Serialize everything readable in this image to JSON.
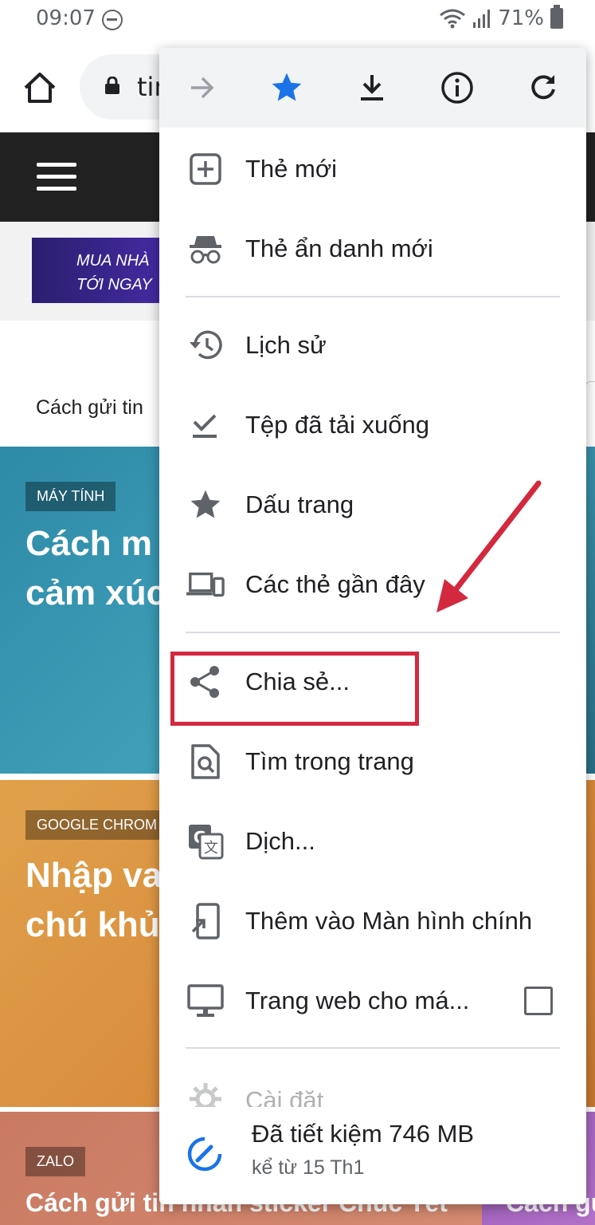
{
  "status_bar": {
    "time": "09:07",
    "battery": "71%"
  },
  "toolbar": {
    "url_fragment": "tin"
  },
  "ad": {
    "line1": "MUA NHÀ",
    "line2": "TỚI NGAY"
  },
  "page": {
    "caption": "Cách gửi tin"
  },
  "cards": [
    {
      "tag": "MÁY TÍNH",
      "title_line1": "Cách m",
      "title_line2": "cảm xúc"
    },
    {
      "tag": "GOOGLE CHROM",
      "title_line1": "Nhập va",
      "title_line2": "chú khủ"
    },
    {
      "tag": "ZALO",
      "title": "Cách gửi tin nhắn sticker Chúc Tết"
    },
    {
      "title": "Cách gử"
    }
  ],
  "menu": {
    "top_icons": [
      "forward-icon",
      "bookmark-star-icon",
      "download-icon",
      "info-icon",
      "reload-icon"
    ],
    "items": [
      {
        "label": "Thẻ mới",
        "icon": "new-tab-icon"
      },
      {
        "label": "Thẻ ẩn danh mới",
        "icon": "incognito-icon"
      },
      {
        "label": "Lịch sử",
        "icon": "history-icon"
      },
      {
        "label": "Tệp đã tải xuống",
        "icon": "downloads-icon"
      },
      {
        "label": "Dấu trang",
        "icon": "bookmarks-icon"
      },
      {
        "label": "Các thẻ gần đây",
        "icon": "recent-tabs-icon"
      },
      {
        "label": "Chia sẻ...",
        "icon": "share-icon"
      },
      {
        "label": "Tìm trong trang",
        "icon": "find-in-page-icon"
      },
      {
        "label": "Dịch...",
        "icon": "translate-icon"
      },
      {
        "label": "Thêm vào Màn hình chính",
        "icon": "add-to-home-icon"
      },
      {
        "label": "Trang web cho má...",
        "icon": "desktop-site-icon"
      },
      {
        "label": "Cài đặt",
        "icon": "settings-icon"
      }
    ],
    "data_saver": {
      "main": "Đã tiết kiệm 746 MB",
      "sub": "kể từ 15 Th1"
    }
  },
  "colors": {
    "accent_blue": "#1a73e8",
    "annotation_red": "#d3293f",
    "icon_gray": "#5f6368"
  }
}
